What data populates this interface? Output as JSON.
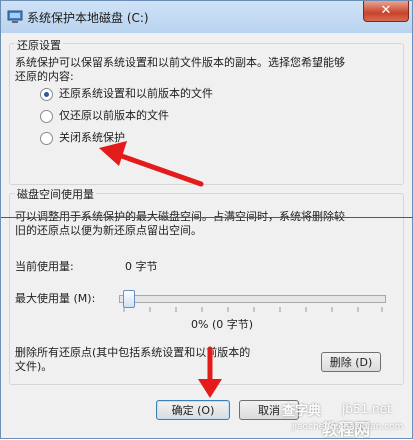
{
  "window": {
    "title": "系统保护本地磁盘 (C:)",
    "close_label": "✕"
  },
  "restore_settings": {
    "group_title": "还原设置",
    "description_line1": "系统保护可以保留系统设置和以前文件版本的副本。选择您希望能够",
    "description_line2": "还原的内容:",
    "options": [
      {
        "label": "还原系统设置和以前版本的文件",
        "selected": true
      },
      {
        "label": "仅还原以前版本的文件",
        "selected": false
      },
      {
        "label": "关闭系统保护",
        "selected": false
      }
    ]
  },
  "disk_usage": {
    "group_title": "磁盘空间使用量",
    "description_line1": "可以调整用于系统保护的最大磁盘空间。占满空间时，系统将删除较",
    "description_line2": "旧的还原点以便为新还原点留出空间。",
    "current_usage_label": "当前使用量:",
    "current_usage_value": "0 字节",
    "max_usage_label": "最大使用量 (M):",
    "slider_percent": 0,
    "slider_value_text": "0% (0 字节)",
    "delete_desc_line1": "删除所有还原点(其中包括系统设置和以前版本的",
    "delete_desc_line2": "文件)。",
    "delete_button": "删除 (D)"
  },
  "footer": {
    "ok_button": "确定 (O)",
    "cancel_button": "取消"
  },
  "watermark": {
    "line1": "查字典",
    "line2": "jb51.net",
    "line3": "jiaocheng.chazidian.com",
    "line4": "教程网"
  },
  "colors": {
    "annotation_red": "#e41b1b",
    "close_button": "#c8442b",
    "title_bar": "#b9d3ef"
  }
}
